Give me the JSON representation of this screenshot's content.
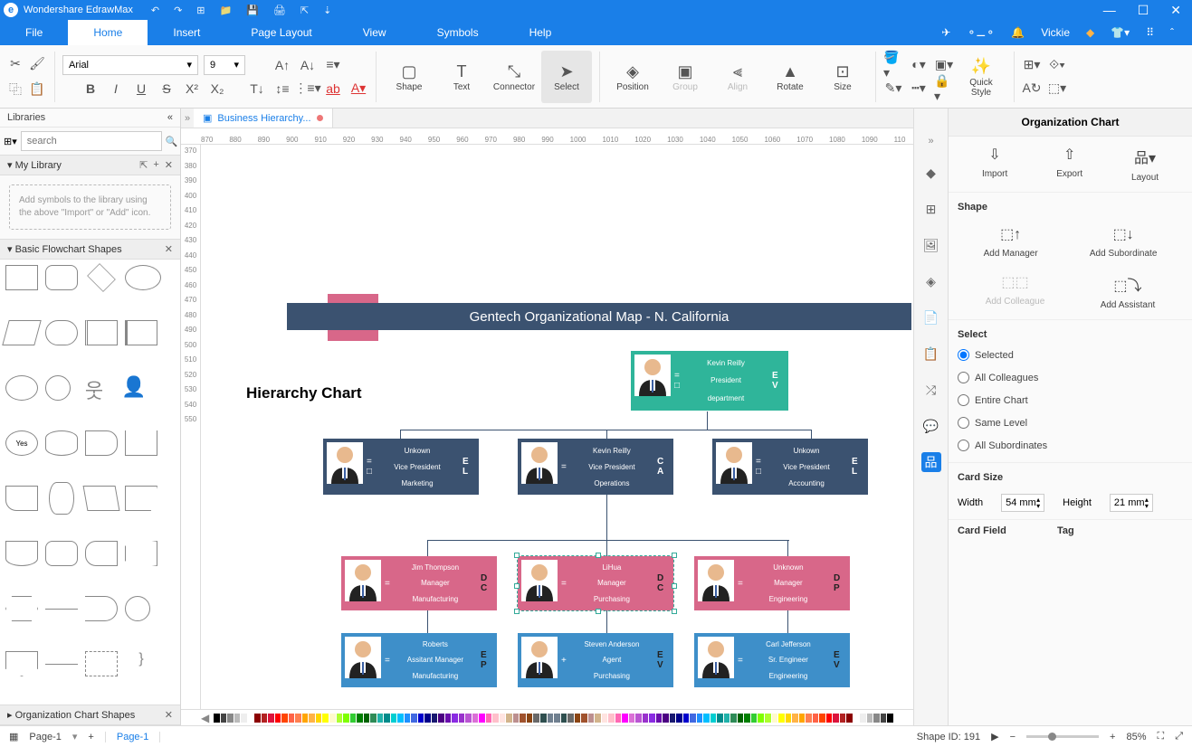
{
  "app": {
    "title": "Wondershare EdrawMax",
    "user": "Vickie"
  },
  "menutabs": {
    "file": "File",
    "home": "Home",
    "insert": "Insert",
    "page": "Page Layout",
    "view": "View",
    "symbols": "Symbols",
    "help": "Help"
  },
  "ribbon": {
    "font": "Arial",
    "size": "9",
    "shape": "Shape",
    "text": "Text",
    "connector": "Connector",
    "select": "Select",
    "position": "Position",
    "group": "Group",
    "align": "Align",
    "rotate": "Rotate",
    "sizelbl": "Size",
    "quick": "Quick\nStyle"
  },
  "left": {
    "libraries": "Libraries",
    "search_ph": "search",
    "mylib": "My Library",
    "hint": "Add symbols to the library using the above \"Import\" or \"Add\" icon.",
    "flowchart": "Basic Flowchart Shapes",
    "orgshapes": "Organization Chart Shapes"
  },
  "doc": {
    "tab": "Business Hierarchy..."
  },
  "ruler_h": [
    "870",
    "880",
    "890",
    "900",
    "910",
    "920",
    "930",
    "940",
    "950",
    "960",
    "970",
    "980",
    "990",
    "1000",
    "1010",
    "1020",
    "1030",
    "1040",
    "1050",
    "1060",
    "1070",
    "1080",
    "1090",
    "110"
  ],
  "ruler_v": [
    "370",
    "380",
    "390",
    "400",
    "410",
    "420",
    "430",
    "440",
    "450",
    "460",
    "470",
    "480",
    "490",
    "500",
    "510",
    "520",
    "530",
    "540",
    "550"
  ],
  "chart": {
    "banner": "Gentech Organizational Map - N. California",
    "heading": "Hierarchy Chart",
    "cards": {
      "c1": {
        "name": "Kevin Reilly",
        "role": "President",
        "dept": "department",
        "code": "E V"
      },
      "c2a": {
        "name": "Unkown",
        "role": "Vice President",
        "dept": "Marketing",
        "code": "E L"
      },
      "c2b": {
        "name": "Kevin Reilly",
        "role": "Vice President",
        "dept": "Operations",
        "code": "C A"
      },
      "c2c": {
        "name": "Unkown",
        "role": "Vice President",
        "dept": "Accounting",
        "code": "E L"
      },
      "c3a": {
        "name": "Jim Thompson",
        "role": "Manager",
        "dept": "Manufacturing",
        "code": "D C"
      },
      "c3b": {
        "name": "LiHua",
        "role": "Manager",
        "dept": "Purchasing",
        "code": "D C"
      },
      "c3c": {
        "name": "Unknown",
        "role": "Manager",
        "dept": "Engineering",
        "code": "D P"
      },
      "c4a": {
        "name": "Roberts",
        "role": "Assitant Manager",
        "dept": "Manufacturing",
        "code": "E P"
      },
      "c4b": {
        "name": "Steven Anderson",
        "role": "Agent",
        "dept": "Purchasing",
        "code": "E V"
      },
      "c4c": {
        "name": "Carl Jefferson",
        "role": "Sr. Engineer",
        "dept": "Engineering",
        "code": "E V"
      }
    }
  },
  "rpanel": {
    "title": "Organization Chart",
    "import": "Import",
    "export": "Export",
    "layout": "Layout",
    "shape": "Shape",
    "addmgr": "Add Manager",
    "addsub": "Add Subordinate",
    "addcol": "Add Colleague",
    "addasst": "Add Assistant",
    "select": "Select",
    "opt1": "Selected",
    "opt2": "All Colleagues",
    "opt3": "Entire Chart",
    "opt4": "Same Level",
    "opt5": "All Subordinates",
    "cardsize": "Card Size",
    "width": "Width",
    "wval": "54 mm",
    "height": "Height",
    "hval": "21 mm",
    "cardfield": "Card Field",
    "tag": "Tag"
  },
  "status": {
    "page": "Page-1",
    "pagetab": "Page-1",
    "shapeid": "Shape ID: 191",
    "zoom": "85%"
  }
}
